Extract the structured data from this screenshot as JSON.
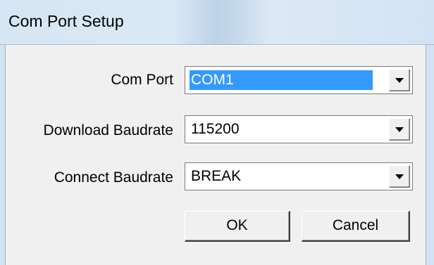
{
  "window": {
    "title": "Com Port Setup"
  },
  "form": {
    "com_port": {
      "label": "Com Port",
      "value": "COM1"
    },
    "download_baudrate": {
      "label": "Download Baudrate",
      "value": "115200"
    },
    "connect_baudrate": {
      "label": "Connect Baudrate",
      "value": "BREAK"
    }
  },
  "buttons": {
    "ok_label": "OK",
    "cancel_label": "Cancel"
  },
  "icons": {
    "dropdown": "chevron-down-icon"
  },
  "colors": {
    "selection": "#3399ff",
    "dialog_background": "#f0f0f0",
    "title_bar": "#d7e6f4"
  }
}
